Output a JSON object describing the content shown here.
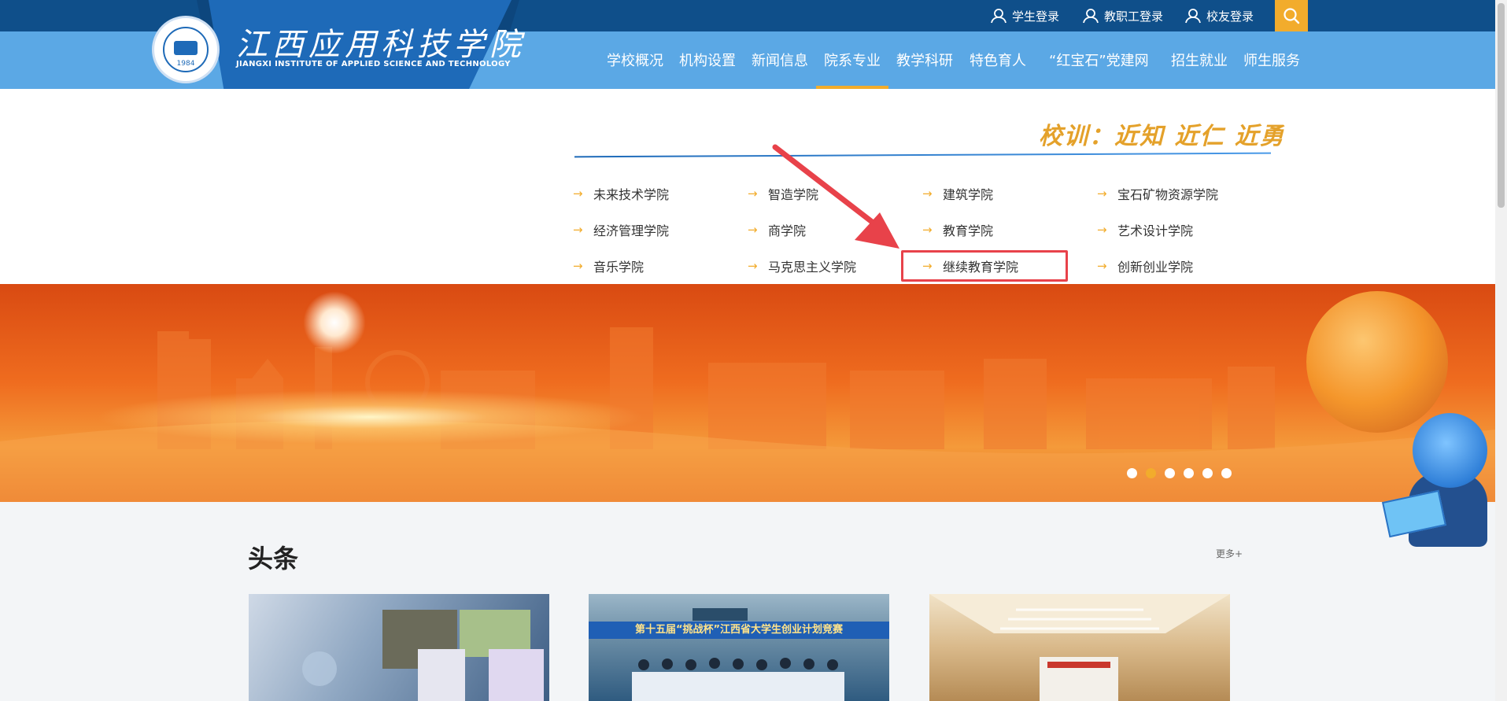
{
  "header": {
    "school_name_cn": "江西应用科技学院",
    "school_name_en": "JIANGXI INSTITUTE OF APPLIED SCIENCE AND TECHNOLOGY",
    "seal_year": "1984",
    "top_links": [
      "学生登录",
      "教职工登录",
      "校友登录"
    ],
    "nav": [
      "学校概况",
      "机构设置",
      "新闻信息",
      "院系专业",
      "教学科研",
      "特色育人",
      "“红宝石”党建网",
      "招生就业",
      "师生服务"
    ],
    "active_nav": "院系专业"
  },
  "dropdown": {
    "motto": "校训：近知 近仁 近勇",
    "departments": [
      [
        "未来技术学院",
        "智造学院",
        "建筑学院",
        "宝石矿物资源学院"
      ],
      [
        "经济管理学院",
        "商学院",
        "教育学院",
        "艺术设计学院"
      ],
      [
        "音乐学院",
        "马克思主义学院",
        "继续教育学院",
        "创新创业学院"
      ]
    ],
    "highlighted": "继续教育学院"
  },
  "banner": {
    "slide_count": 6,
    "active_slide": 2
  },
  "content": {
    "section_title": "头条",
    "more_label": "更多+",
    "card2_caption": "第十五届“挑战杯”江西省大学生创业计划竞赛"
  },
  "colors": {
    "topbar": "#0f4f8a",
    "navbar": "#5ba8e5",
    "accent": "#f2ac2c",
    "highlight": "#e8424a"
  }
}
